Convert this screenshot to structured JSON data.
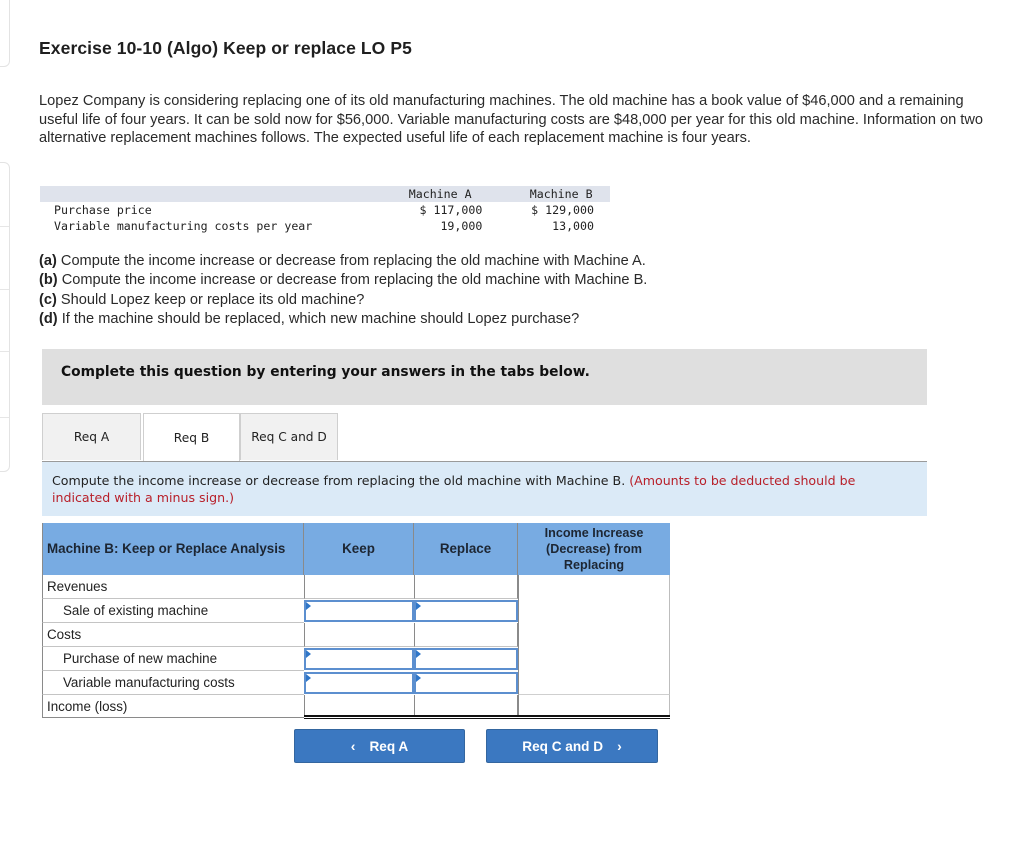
{
  "exercise": {
    "title": "Exercise 10-10 (Algo) Keep or replace LO P5",
    "intro": "Lopez Company is considering replacing one of its old manufacturing machines. The old machine has a book value of $46,000 and a remaining useful life of four years. It can be sold now for $56,000. Variable manufacturing costs are $48,000 per year for this old machine. Information on two alternative replacement machines follows. The expected useful life of each replacement machine is four years."
  },
  "machine_table": {
    "headers": [
      "",
      "Machine A",
      "Machine B"
    ],
    "rows": [
      {
        "label": "Purchase price",
        "a": "$ 117,000",
        "b": "$ 129,000"
      },
      {
        "label": "Variable manufacturing costs per year",
        "a": "19,000",
        "b": "13,000"
      }
    ]
  },
  "requirements": [
    {
      "tag": "(a)",
      "text": " Compute the income increase or decrease from replacing the old machine with Machine A."
    },
    {
      "tag": "(b)",
      "text": " Compute the income increase or decrease from replacing the old machine with Machine B."
    },
    {
      "tag": "(c)",
      "text": " Should Lopez keep or replace its old machine?"
    },
    {
      "tag": "(d)",
      "text": " If the machine should be replaced, which new machine should Lopez purchase?"
    }
  ],
  "instruction": "Complete this question by entering your answers in the tabs below.",
  "tabs": [
    {
      "label": "Req A",
      "active": false
    },
    {
      "label": "Req B",
      "active": true
    },
    {
      "label": "Req C and D",
      "active": false
    }
  ],
  "prompt": {
    "text": "Compute the income increase or decrease from replacing the old machine with Machine B. ",
    "note": "(Amounts to be deducted should be indicated with a minus sign.)"
  },
  "analysis": {
    "headers": [
      "Machine B: Keep or Replace Analysis",
      "Keep",
      "Replace",
      "Income Increase (Decrease) from Replacing"
    ],
    "rows": [
      {
        "label": "Revenues",
        "indent": false,
        "keep": "",
        "replace": "",
        "inputs": false
      },
      {
        "label": "Sale of existing machine",
        "indent": true,
        "keep": "",
        "replace": "",
        "inputs": true
      },
      {
        "label": "Costs",
        "indent": false,
        "keep": "",
        "replace": "",
        "inputs": false
      },
      {
        "label": "Purchase of new machine",
        "indent": true,
        "keep": "",
        "replace": "",
        "inputs": true
      },
      {
        "label": "Variable manufacturing costs",
        "indent": true,
        "keep": "",
        "replace": "",
        "inputs": true
      },
      {
        "label": "Income (loss)",
        "indent": false,
        "keep": "",
        "replace": "",
        "inputs": false
      }
    ],
    "income_difference": ""
  },
  "nav": {
    "prev_label": "Req A",
    "next_label": "Req C and D",
    "prev_icon": "chevron-left-icon",
    "next_icon": "chevron-right-icon"
  },
  "colors": {
    "header_blue": "#78abe2",
    "button_blue": "#3b78c1",
    "prompt_bg": "#dbeaf7",
    "note_red": "#b8202a",
    "instruction_bg": "#dfdfdf"
  }
}
